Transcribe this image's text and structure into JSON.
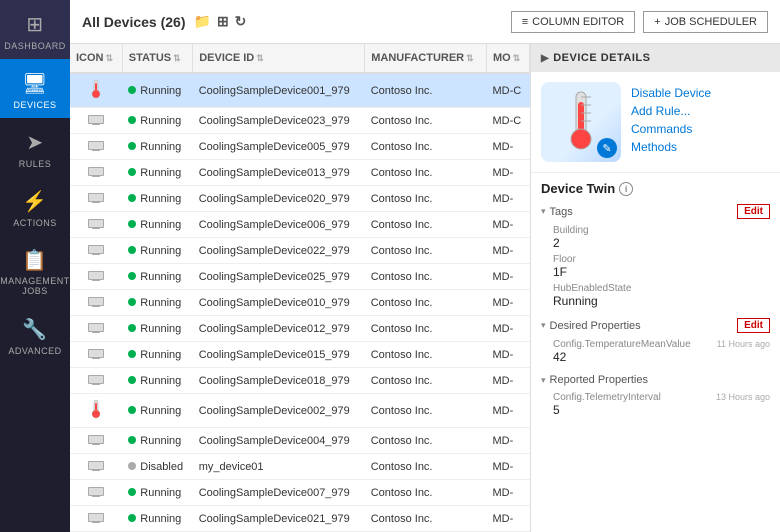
{
  "sidebar": {
    "items": [
      {
        "id": "dashboard",
        "label": "Dashboard",
        "icon": "⊞",
        "active": false
      },
      {
        "id": "devices",
        "label": "Devices",
        "icon": "💻",
        "active": true
      },
      {
        "id": "rules",
        "label": "Rules",
        "icon": "➤",
        "active": false
      },
      {
        "id": "actions",
        "label": "Actions",
        "icon": "⚡",
        "active": false
      },
      {
        "id": "management-jobs",
        "label": "Management Jobs",
        "icon": "📋",
        "active": false
      },
      {
        "id": "advanced",
        "label": "Advanced",
        "icon": "🔧",
        "active": false
      }
    ]
  },
  "topbar": {
    "title": "All Devices (26)",
    "column_editor_label": "COLUMN EDITOR",
    "job_scheduler_label": "JOB SCHEDULER"
  },
  "table": {
    "columns": [
      "ICON",
      "STATUS",
      "DEVICE ID",
      "MANUFACTURER",
      "MO"
    ],
    "rows": [
      {
        "icon": "🌡️",
        "status": "Running",
        "device_id": "CoolingSampleDevice001_979",
        "manufacturer": "Contoso Inc.",
        "model": "MD-C",
        "selected": true,
        "has_badge": true
      },
      {
        "icon": "🖥️",
        "status": "Running",
        "device_id": "CoolingSampleDevice023_979",
        "manufacturer": "Contoso Inc.",
        "model": "MD-C",
        "selected": false,
        "has_badge": false
      },
      {
        "icon": "🖥️",
        "status": "Running",
        "device_id": "CoolingSampleDevice005_979",
        "manufacturer": "Contoso Inc.",
        "model": "MD-",
        "selected": false,
        "has_badge": false
      },
      {
        "icon": "🖥️",
        "status": "Running",
        "device_id": "CoolingSampleDevice013_979",
        "manufacturer": "Contoso Inc.",
        "model": "MD-",
        "selected": false,
        "has_badge": false
      },
      {
        "icon": "🖥️",
        "status": "Running",
        "device_id": "CoolingSampleDevice020_979",
        "manufacturer": "Contoso Inc.",
        "model": "MD-",
        "selected": false,
        "has_badge": false
      },
      {
        "icon": "🖥️",
        "status": "Running",
        "device_id": "CoolingSampleDevice006_979",
        "manufacturer": "Contoso Inc.",
        "model": "MD-",
        "selected": false,
        "has_badge": false
      },
      {
        "icon": "🖥️",
        "status": "Running",
        "device_id": "CoolingSampleDevice022_979",
        "manufacturer": "Contoso Inc.",
        "model": "MD-",
        "selected": false,
        "has_badge": false
      },
      {
        "icon": "🖥️",
        "status": "Running",
        "device_id": "CoolingSampleDevice025_979",
        "manufacturer": "Contoso Inc.",
        "model": "MD-",
        "selected": false,
        "has_badge": false
      },
      {
        "icon": "🖥️",
        "status": "Running",
        "device_id": "CoolingSampleDevice010_979",
        "manufacturer": "Contoso Inc.",
        "model": "MD-",
        "selected": false,
        "has_badge": false
      },
      {
        "icon": "🖥️",
        "status": "Running",
        "device_id": "CoolingSampleDevice012_979",
        "manufacturer": "Contoso Inc.",
        "model": "MD-",
        "selected": false,
        "has_badge": false
      },
      {
        "icon": "🖥️",
        "status": "Running",
        "device_id": "CoolingSampleDevice015_979",
        "manufacturer": "Contoso Inc.",
        "model": "MD-",
        "selected": false,
        "has_badge": false
      },
      {
        "icon": "🖥️",
        "status": "Running",
        "device_id": "CoolingSampleDevice018_979",
        "manufacturer": "Contoso Inc.",
        "model": "MD-",
        "selected": false,
        "has_badge": false
      },
      {
        "icon": "🌡️",
        "status": "Running",
        "device_id": "CoolingSampleDevice002_979",
        "manufacturer": "Contoso Inc.",
        "model": "MD-",
        "selected": false,
        "has_badge": true
      },
      {
        "icon": "🖥️",
        "status": "Running",
        "device_id": "CoolingSampleDevice004_979",
        "manufacturer": "Contoso Inc.",
        "model": "MD-",
        "selected": false,
        "has_badge": false
      },
      {
        "icon": "🖥️",
        "status": "Disabled",
        "device_id": "my_device01",
        "manufacturer": "Contoso Inc.",
        "model": "MD-",
        "selected": false,
        "has_badge": false
      },
      {
        "icon": "🖥️",
        "status": "Running",
        "device_id": "CoolingSampleDevice007_979",
        "manufacturer": "Contoso Inc.",
        "model": "MD-",
        "selected": false,
        "has_badge": false
      },
      {
        "icon": "🖥️",
        "status": "Running",
        "device_id": "CoolingSampleDevice021_979",
        "manufacturer": "Contoso Inc.",
        "model": "MD-",
        "selected": false,
        "has_badge": false
      }
    ]
  },
  "details": {
    "header": "DEVICE DETAILS",
    "actions": [
      {
        "id": "disable-device",
        "label": "Disable Device"
      },
      {
        "id": "add-rule",
        "label": "Add Rule..."
      },
      {
        "id": "commands",
        "label": "Commands"
      },
      {
        "id": "methods",
        "label": "Methods"
      }
    ],
    "device_twin_title": "Device Twin",
    "tags_label": "Tags",
    "tags_edit_label": "Edit",
    "tags": [
      {
        "label": "Building",
        "value": "2"
      },
      {
        "label": "Floor",
        "value": "1F"
      },
      {
        "label": "HubEnabledState",
        "value": "Running"
      }
    ],
    "desired_label": "Desired Properties",
    "desired_edit_label": "Edit",
    "desired": [
      {
        "label": "Config.TemperatureMeanValue",
        "value": "42",
        "meta": "11 Hours ago"
      }
    ],
    "reported_label": "Reported Properties",
    "reported": [
      {
        "label": "Config.TelemetryInterval",
        "value": "5",
        "meta": "13 Hours ago"
      }
    ]
  }
}
